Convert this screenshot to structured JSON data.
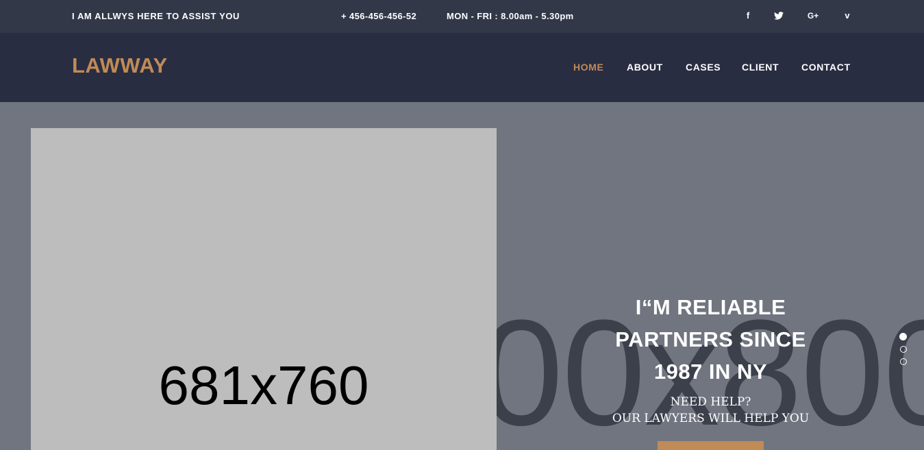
{
  "topbar": {
    "tagline": "I AM ALLWYS HERE TO ASSIST YOU",
    "phone": "+ 456-456-456-52",
    "hours": "MON - FRI : 8.00am - 5.30pm",
    "social": {
      "facebook": "f",
      "twitter": "🐦",
      "googleplus": "G+",
      "vimeo": "v"
    }
  },
  "header": {
    "logo": "LAWWAY",
    "nav": {
      "home": "HOME",
      "about": "ABOUT",
      "cases": "CASES",
      "client": "CLIENT",
      "contact": "CONTACT"
    },
    "active_nav": "HOME"
  },
  "hero": {
    "left_image_label": "681x760",
    "background_image_label": "00x800",
    "headline_line1": "I“M RELIABLE",
    "headline_line2": "PARTNERS SINCE",
    "headline_line3": "1987 IN NY",
    "subline1": "NEED HELP?",
    "subline2": "OUR LAWYERS WILL HELP YOU",
    "slider": {
      "total_slides": 3,
      "active_slide": 1
    }
  },
  "colors": {
    "accent": "#c08b56",
    "topbar_bg": "#333849",
    "navbar_bg": "#292d42",
    "hero_bg": "#717580",
    "placeholder_bg": "#bdbdbd"
  }
}
